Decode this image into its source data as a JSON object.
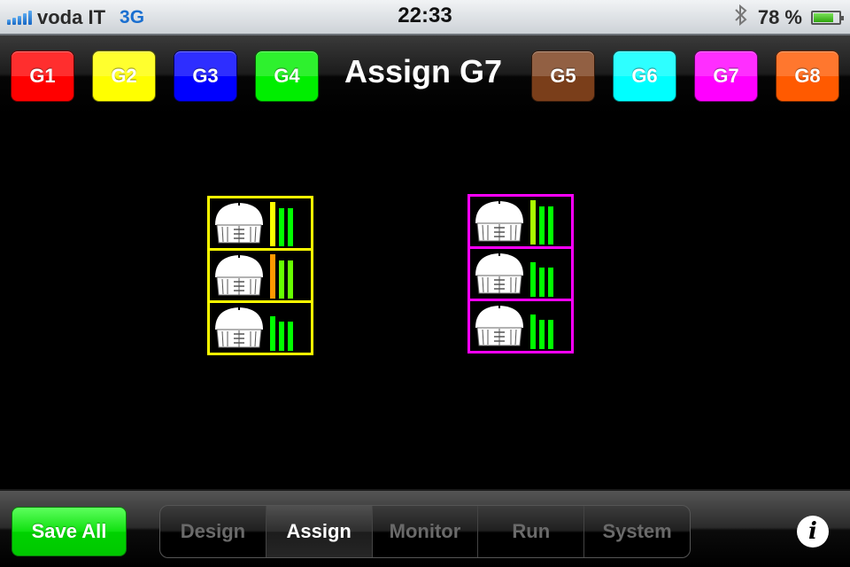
{
  "status_bar": {
    "carrier": "voda IT",
    "network": "3G",
    "time": "22:33",
    "bluetooth_icon": "bluetooth-icon",
    "battery_percent_label": "78 %",
    "battery_level": 0.78,
    "signal_bars": 5
  },
  "header": {
    "title": "Assign G7",
    "group_buttons": [
      {
        "label": "G1",
        "color": "#ff0000"
      },
      {
        "label": "G2",
        "color": "#ffff00"
      },
      {
        "label": "G3",
        "color": "#0000ff"
      },
      {
        "label": "G4",
        "color": "#00ee00"
      },
      {
        "label": "G5",
        "color": "#7a3e1a"
      },
      {
        "label": "G6",
        "color": "#00ffff"
      },
      {
        "label": "G7",
        "color": "#ff00ff"
      },
      {
        "label": "G8",
        "color": "#ff5a00"
      }
    ]
  },
  "device_groups": [
    {
      "group": "G2",
      "border_color": "#ffff00",
      "devices": [
        {
          "icon": "speaker-cabinet-icon",
          "meters": [
            {
              "level": 0.92,
              "color": "#ffff00"
            },
            {
              "level": 0.8,
              "color": "#00ff00"
            },
            {
              "level": 0.8,
              "color": "#00ff00"
            }
          ]
        },
        {
          "icon": "speaker-cabinet-icon",
          "meters": [
            {
              "level": 0.92,
              "color": "#ff9900"
            },
            {
              "level": 0.8,
              "color": "#66ff00"
            },
            {
              "level": 0.8,
              "color": "#66ff00"
            }
          ]
        },
        {
          "icon": "speaker-cabinet-icon",
          "meters": [
            {
              "level": 0.72,
              "color": "#00ff00"
            },
            {
              "level": 0.62,
              "color": "#00ff00"
            },
            {
              "level": 0.62,
              "color": "#00ff00"
            }
          ]
        }
      ]
    },
    {
      "group": "G7",
      "border_color": "#ff00ff",
      "devices": [
        {
          "icon": "speaker-cabinet-icon",
          "meters": [
            {
              "level": 0.92,
              "color": "#aaff00"
            },
            {
              "level": 0.8,
              "color": "#00ff00"
            },
            {
              "level": 0.8,
              "color": "#00ff00"
            }
          ]
        },
        {
          "icon": "speaker-cabinet-icon",
          "meters": [
            {
              "level": 0.72,
              "color": "#00ff00"
            },
            {
              "level": 0.62,
              "color": "#00ff00"
            },
            {
              "level": 0.62,
              "color": "#00ff00"
            }
          ]
        },
        {
          "icon": "speaker-cabinet-icon",
          "meters": [
            {
              "level": 0.72,
              "color": "#00ff00"
            },
            {
              "level": 0.62,
              "color": "#00ff00"
            },
            {
              "level": 0.62,
              "color": "#00ff00"
            }
          ]
        }
      ]
    }
  ],
  "footer": {
    "save_label": "Save All",
    "save_color": "#00dd00",
    "tabs": [
      {
        "label": "Design",
        "active": false
      },
      {
        "label": "Assign",
        "active": true
      },
      {
        "label": "Monitor",
        "active": false
      },
      {
        "label": "Run",
        "active": false
      },
      {
        "label": "System",
        "active": false
      }
    ],
    "info_label": "i"
  }
}
